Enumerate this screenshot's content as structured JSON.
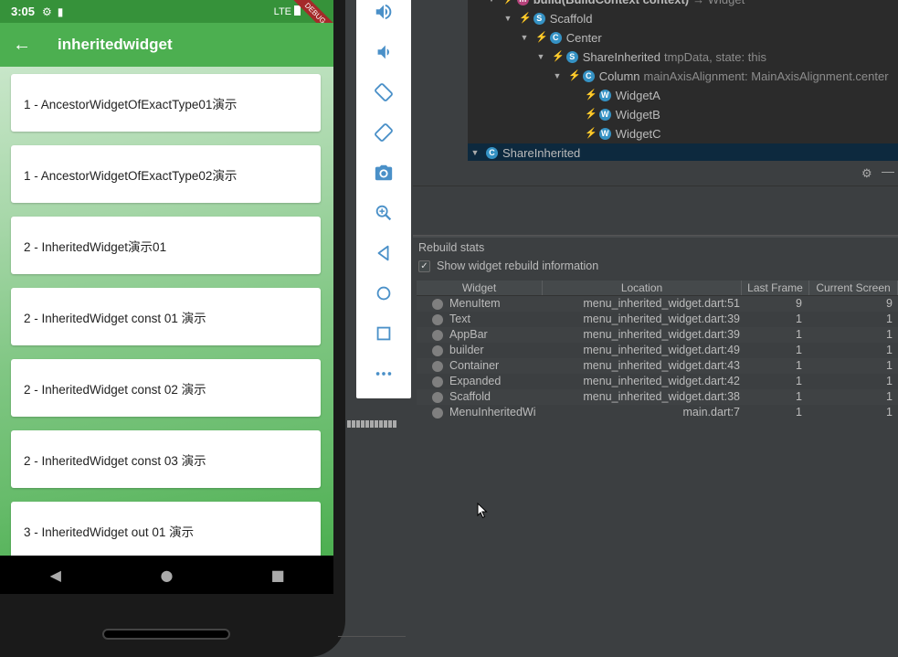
{
  "status_bar": {
    "time": "3:05",
    "network": "LTE"
  },
  "debug_ribbon": "DEBUG",
  "app_bar": {
    "title": "inheritedwidget"
  },
  "menu_items": [
    {
      "label": "1 - AncestorWidgetOfExactType01演示"
    },
    {
      "label": "1 - AncestorWidgetOfExactType02演示"
    },
    {
      "label": "2 - InheritedWidget演示01"
    },
    {
      "label": "2 - InheritedWidget const 01 演示"
    },
    {
      "label": "2 - InheritedWidget const 02 演示"
    },
    {
      "label": "2 - InheritedWidget const 03 演示"
    },
    {
      "label": "3 - InheritedWidget out 01 演示"
    }
  ],
  "widget_tree": {
    "rows": [
      {
        "badge": "m",
        "name": "build(BuildContext context)",
        "prop": "→ Widget"
      },
      {
        "badge": "S",
        "name": "Scaffold",
        "prop": ""
      },
      {
        "badge": "C",
        "name": "Center",
        "prop": ""
      },
      {
        "badge": "S",
        "name": "ShareInherited",
        "prop": "tmpData, state: this"
      },
      {
        "badge": "C",
        "name": "Column",
        "prop": "mainAxisAlignment: MainAxisAlignment.center"
      },
      {
        "badge": "W",
        "name": "WidgetA",
        "prop": ""
      },
      {
        "badge": "W",
        "name": "WidgetB",
        "prop": ""
      },
      {
        "badge": "W",
        "name": "WidgetC",
        "prop": ""
      },
      {
        "badge": "C",
        "name": "ShareInherited",
        "prop": ""
      }
    ]
  },
  "rebuild_stats": {
    "title": "Rebuild stats",
    "checkbox_label": "Show widget rebuild information",
    "columns": [
      "Widget",
      "Location",
      "Last Frame",
      "Current Screen"
    ],
    "rows": [
      {
        "widget": "MenuItem",
        "location": "menu_inherited_widget.dart:51",
        "last_frame": "9",
        "current_screen": "9"
      },
      {
        "widget": "Text",
        "location": "menu_inherited_widget.dart:39",
        "last_frame": "1",
        "current_screen": "1"
      },
      {
        "widget": "AppBar",
        "location": "menu_inherited_widget.dart:39",
        "last_frame": "1",
        "current_screen": "1"
      },
      {
        "widget": "builder",
        "location": "menu_inherited_widget.dart:49",
        "last_frame": "1",
        "current_screen": "1"
      },
      {
        "widget": "Container",
        "location": "menu_inherited_widget.dart:43",
        "last_frame": "1",
        "current_screen": "1"
      },
      {
        "widget": "Expanded",
        "location": "menu_inherited_widget.dart:42",
        "last_frame": "1",
        "current_screen": "1"
      },
      {
        "widget": "Scaffold",
        "location": "menu_inherited_widget.dart:38",
        "last_frame": "1",
        "current_screen": "1"
      },
      {
        "widget": "MenuInheritedWi",
        "location": "main.dart:7",
        "last_frame": "1",
        "current_screen": "1"
      }
    ]
  },
  "emulator_tools": [
    "volume-up-icon",
    "volume-down-icon",
    "rotate-left-icon",
    "rotate-right-icon",
    "camera-icon",
    "zoom-icon",
    "back-icon",
    "home-icon",
    "overview-icon",
    "more-icon"
  ],
  "colors": {
    "app_bar": "#4caf50",
    "status_bar": "#36923a",
    "tree_bg": "#2b2b2b",
    "tree_selected": "#0d293e",
    "flutter_blue": "#5fb7f0"
  }
}
